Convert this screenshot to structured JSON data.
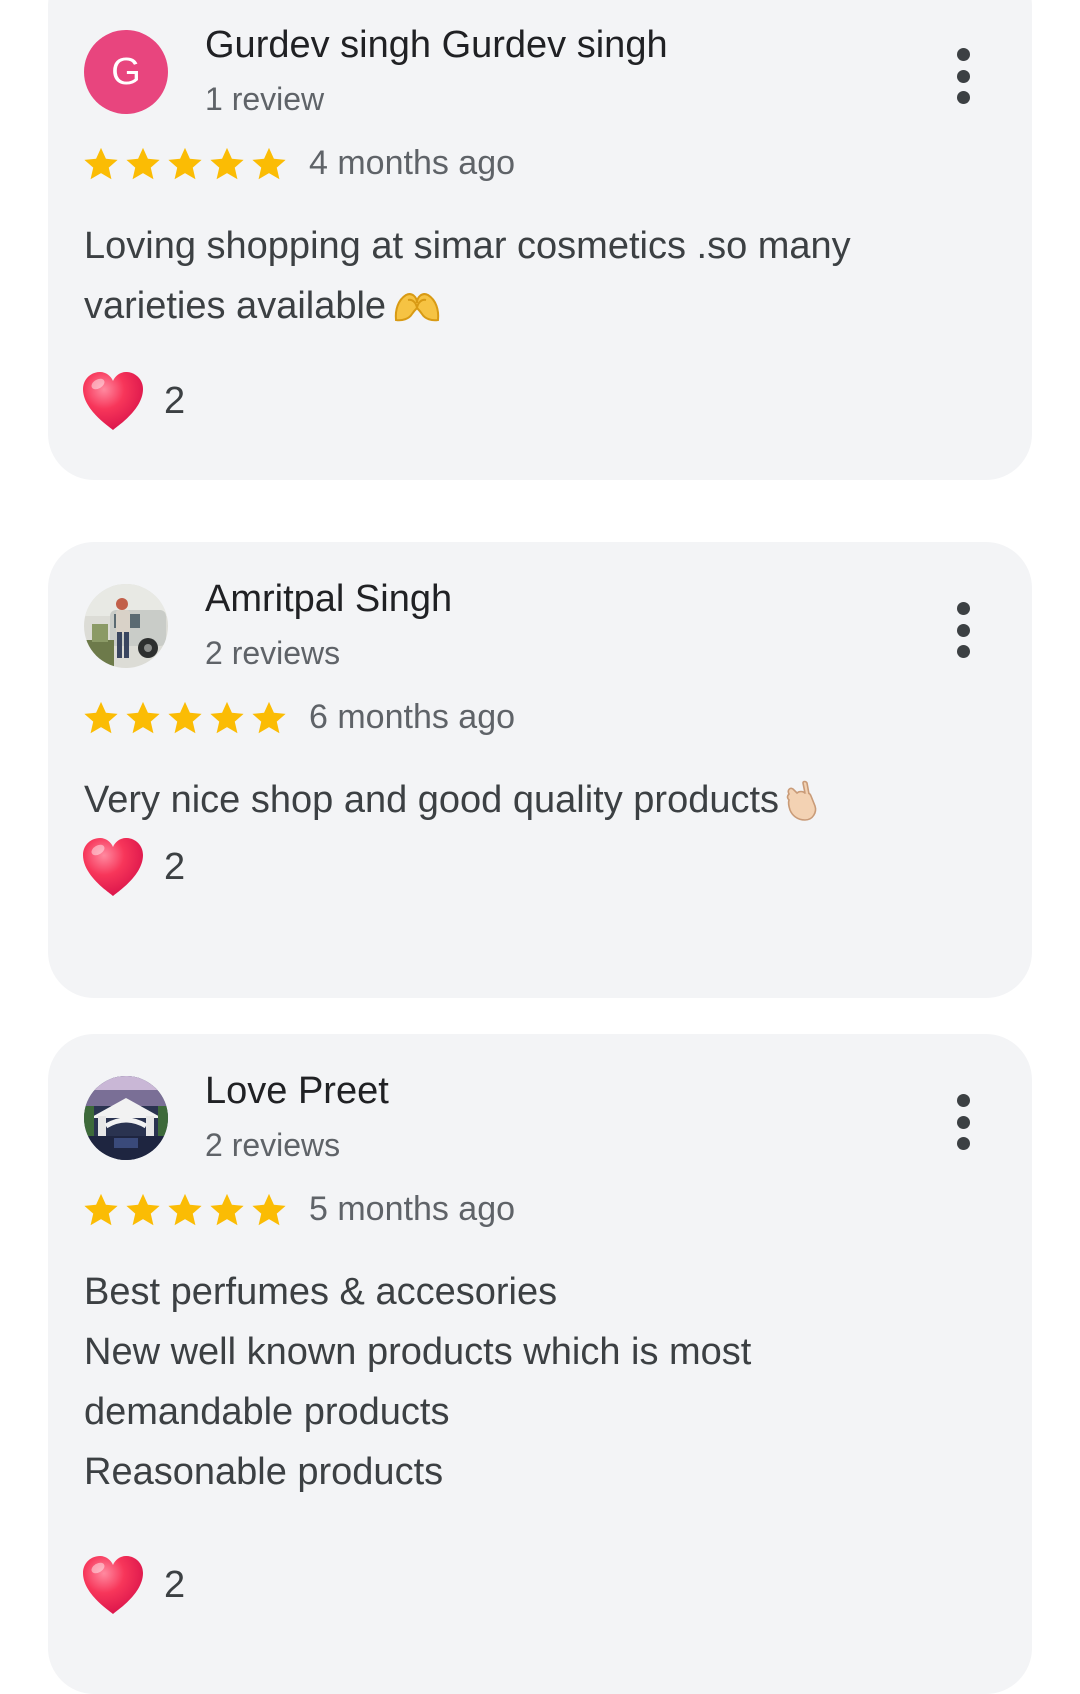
{
  "reviews": [
    {
      "avatar_letter": "G",
      "avatar_color": "#e8457e",
      "name": "Gurdev singh Gurdev singh",
      "review_count": "1 review",
      "rating": 5,
      "time_ago": "4 months ago",
      "text_lines": [
        "Loving shopping at simar cosmetics .so many",
        "varieties available"
      ],
      "emoji": "heart-hands-icon",
      "likes": "2"
    },
    {
      "avatar_letter": "",
      "name": "Amritpal Singh",
      "review_count": "2 reviews",
      "rating": 5,
      "time_ago": "6 months ago",
      "text_lines": [
        "Very nice shop and good quality products"
      ],
      "emoji": "call-me-hand-icon",
      "likes": "2"
    },
    {
      "avatar_letter": "",
      "name": "Love Preet",
      "review_count": "2 reviews",
      "rating": 5,
      "time_ago": "5 months ago",
      "text_lines": [
        "Best perfumes & accesories",
        "New well known products which is most",
        "demandable products",
        "Reasonable products"
      ],
      "emoji": "",
      "likes": "2"
    }
  ],
  "colors": {
    "star": "#fbbc04",
    "heart": "#f0445f",
    "card_bg": "#f3f4f6",
    "accent_avatar": "#e8457e"
  }
}
